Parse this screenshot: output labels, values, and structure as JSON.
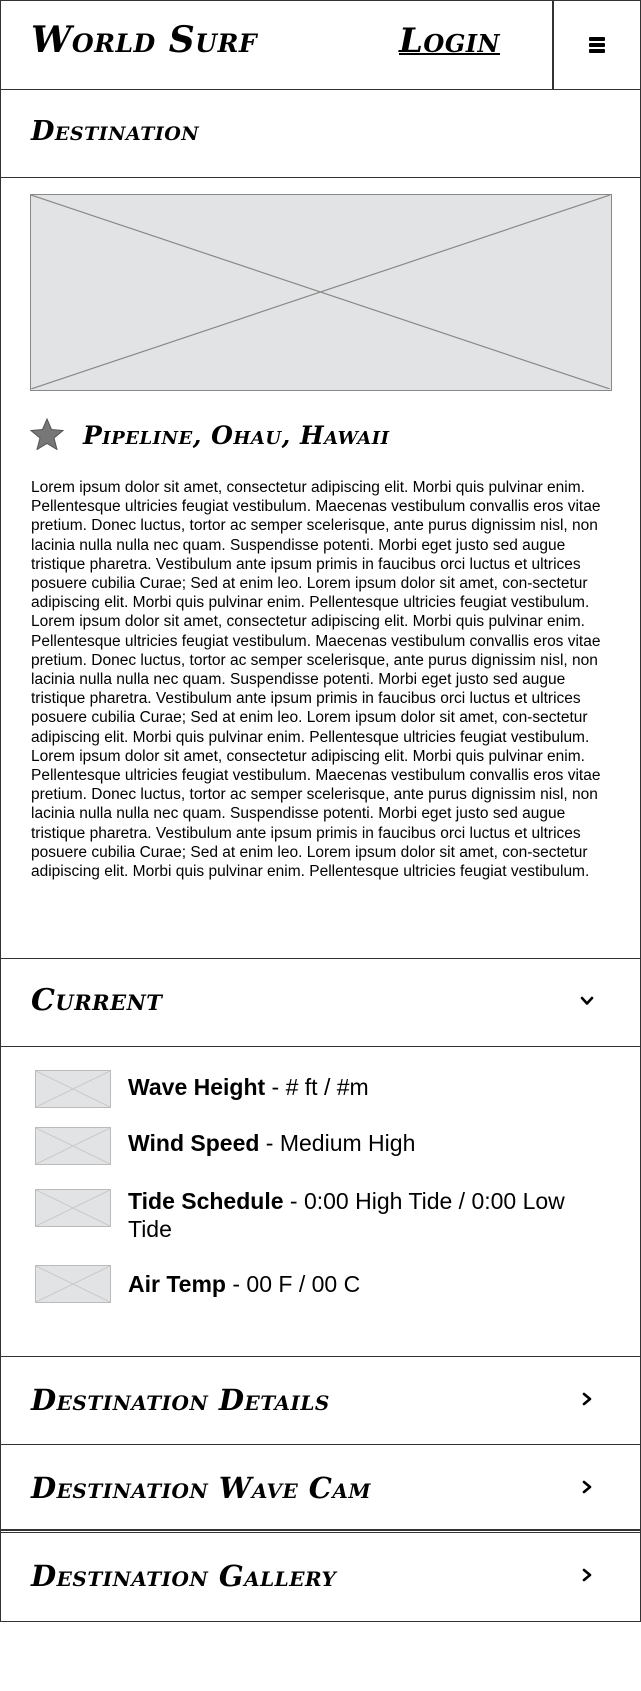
{
  "header": {
    "brand": "World Surf",
    "login_label": "Login",
    "menu_icon": "hamburger-menu-icon"
  },
  "destination_header": {
    "title": "Destination"
  },
  "main": {
    "hero_image": "placeholder-image",
    "favorite_icon": "star-icon",
    "spot_name": "Pipeline, Ohau, Hawaii",
    "paragraphs": [
      "Lorem ipsum dolor sit amet, consectetur adipiscing elit. Morbi quis pulvinar enim. Pellentesque ultricies feugiat vestibulum. Maecenas vestibulum convallis eros vitae pretium. Donec luctus, tortor ac semper scelerisque, ante purus dignissim nisl, non lacinia nulla nulla nec quam. Suspendisse potenti. Morbi eget justo sed augue tristique pharetra. Vestibulum ante ipsum primis in faucibus orci luctus et ultrices posuere cubilia Curae; Sed at enim leo. Lorem ipsum dolor sit amet, con-sectetur adipiscing elit. Morbi quis pulvinar enim. Pellentesque ultricies feugiat vestibulum.",
      "Lorem ipsum dolor sit amet, consectetur adipiscing elit. Morbi quis pulvinar enim. Pellentesque ultricies feugiat vestibulum. Maecenas vestibulum convallis eros vitae pretium. Donec luctus, tortor ac semper scelerisque, ante purus dignissim nisl, non lacinia nulla nulla nec quam. Suspendisse potenti. Morbi eget justo sed augue tristique pharetra. Vestibulum ante ipsum primis in faucibus orci luctus et ultrices posuere cubilia Curae; Sed at enim leo. Lorem ipsum dolor sit amet, con-sectetur adipiscing elit. Morbi quis pulvinar enim. Pellentesque ultricies feugiat vestibulum.",
      "Lorem ipsum dolor sit amet, consectetur adipiscing elit. Morbi quis pulvinar enim. Pellentesque ultricies feugiat vestibulum. Maecenas vestibulum convallis eros vitae pretium. Donec luctus, tortor ac semper scelerisque, ante purus dignissim nisl, non lacinia nulla nulla nec quam. Suspendisse potenti. Morbi eget justo sed augue tristique pharetra. Vestibulum ante ipsum primis in faucibus orci luctus et ultrices posuere cubilia Curae; Sed at enim leo. Lorem ipsum dolor sit amet, con-sectetur adipiscing elit. Morbi quis pulvinar enim. Pellentesque ultricies feugiat vestibulum."
    ]
  },
  "current": {
    "title": "Current",
    "toggle_icon": "chevron-down-icon",
    "conditions": [
      {
        "label": "Wave Height",
        "value": " - # ft / #m"
      },
      {
        "label": "Wind Speed",
        "value": " - Medium High"
      },
      {
        "label": "Tide Schedule",
        "value": " - 0:00 High Tide / 0:00 Low Tide"
      },
      {
        "label": "Air Temp",
        "value": " - 00 F / 00 C"
      }
    ]
  },
  "sections": [
    {
      "title": "Destination Details",
      "icon": "chevron-right-icon"
    },
    {
      "title": "Destination Wave Cam",
      "icon": "chevron-right-icon"
    },
    {
      "title": "Destination Gallery",
      "icon": "chevron-right-icon"
    }
  ],
  "colors": {
    "border": "#333333",
    "placeholder_fill": "#e2e3e4",
    "placeholder_line": "#888888",
    "star_fill": "#777777"
  }
}
